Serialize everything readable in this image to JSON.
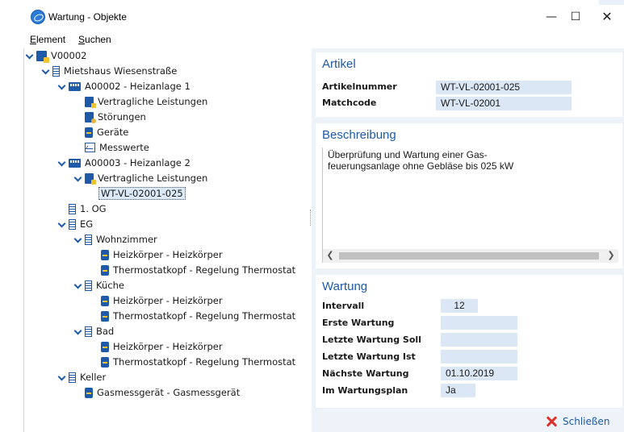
{
  "window": {
    "title": "Wartung - Objekte",
    "minimize": "—",
    "maximize": "☐",
    "close": "✕"
  },
  "menu": {
    "element": {
      "u": "E",
      "rest": "lement"
    },
    "suchen": {
      "u": "S",
      "rest": "uchen"
    }
  },
  "tree": [
    {
      "label": "V00002",
      "icon": "object-folder-icon",
      "expander": "expanded"
    },
    {
      "label": "Mietshaus Wiesenstraße",
      "icon": "building-icon",
      "expander": "expanded"
    },
    {
      "label": "A00002 - Heizanlage 1",
      "icon": "plant-icon",
      "expander": "expanded"
    },
    {
      "label": "Vertragliche Leistungen",
      "icon": "contract-icon",
      "expander": "collapsed"
    },
    {
      "label": "Störungen",
      "icon": "fault-icon",
      "expander": "collapsed"
    },
    {
      "label": "Geräte",
      "icon": "device-icon",
      "expander": "collapsed"
    },
    {
      "label": "Messwerte",
      "icon": "measure-icon",
      "expander": "collapsed"
    },
    {
      "label": "A00003 - Heizanlage 2",
      "icon": "plant-icon",
      "expander": "expanded"
    },
    {
      "label": "Vertragliche Leistungen",
      "icon": "contract-icon",
      "expander": "expanded"
    },
    {
      "label": "WT-VL-02001-025",
      "icon": "",
      "expander": "none",
      "selected": true
    },
    {
      "label": "1. OG",
      "icon": "building-icon",
      "expander": "none"
    },
    {
      "label": "EG",
      "icon": "building-icon",
      "expander": "expanded"
    },
    {
      "label": "Wohnzimmer",
      "icon": "building-icon",
      "expander": "expanded"
    },
    {
      "label": "Heizkörper - Heizkörper",
      "icon": "device-icon",
      "expander": "none"
    },
    {
      "label": "Thermostatkopf - Regelung Thermostat",
      "icon": "device-icon",
      "expander": "none"
    },
    {
      "label": "Küche",
      "icon": "building-icon",
      "expander": "expanded"
    },
    {
      "label": "Heizkörper - Heizkörper",
      "icon": "device-icon",
      "expander": "none"
    },
    {
      "label": "Thermostatkopf - Regelung Thermostat",
      "icon": "device-icon",
      "expander": "none"
    },
    {
      "label": "Bad",
      "icon": "building-icon",
      "expander": "expanded"
    },
    {
      "label": "Heizkörper - Heizkörper",
      "icon": "device-icon",
      "expander": "none"
    },
    {
      "label": "Thermostatkopf - Regelung Thermostat",
      "icon": "device-icon",
      "expander": "none"
    },
    {
      "label": "Keller",
      "icon": "building-icon",
      "expander": "expanded"
    },
    {
      "label": "Gasmessgerät - Gasmessgerät",
      "icon": "device-icon",
      "expander": "none"
    }
  ],
  "artikel": {
    "title": "Artikel",
    "artikelnummer_label": "Artikelnummer",
    "artikelnummer_value": "WT-VL-02001-025",
    "matchcode_label": "Matchcode",
    "matchcode_value": "WT-VL-02001"
  },
  "beschreibung": {
    "title": "Beschreibung",
    "text": "Überprüfung und Wartung einer Gas-\nfeuerungsanlage ohne Gebläse bis 025 kW"
  },
  "wartung": {
    "title": "Wartung",
    "intervall_label": "Intervall",
    "intervall_value": "12",
    "erste_label": "Erste Wartung",
    "erste_value": "",
    "letzte_soll_label": "Letzte Wartung Soll",
    "letzte_soll_value": "",
    "letzte_ist_label": "Letzte Wartung Ist",
    "letzte_ist_value": "",
    "naechste_label": "Nächste Wartung",
    "naechste_value": "01.10.2019",
    "plan_label": "Im Wartungsplan",
    "plan_value": "Ja"
  },
  "footer": {
    "close_label": "Schließen"
  }
}
